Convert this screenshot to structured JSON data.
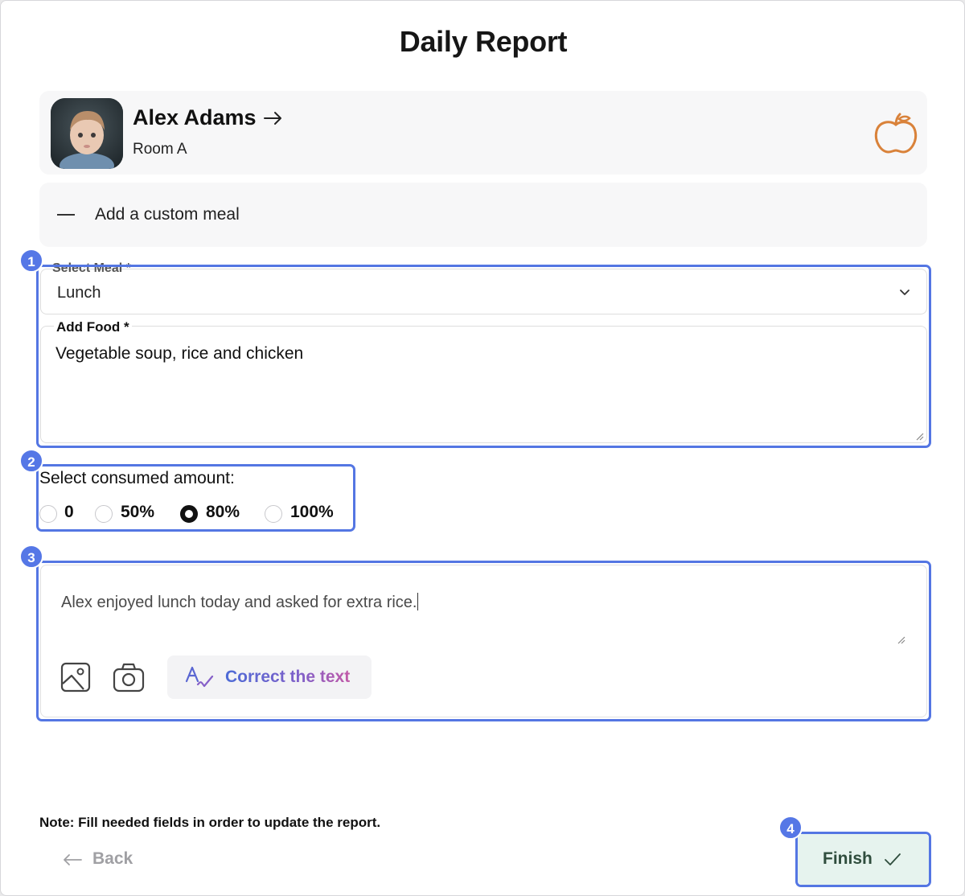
{
  "page": {
    "title": "Daily Report"
  },
  "child": {
    "name": "Alex Adams",
    "room": "Room A",
    "category_icon": "apple-icon"
  },
  "custom_meal": {
    "label": "Add a custom meal",
    "icon": "minus-icon"
  },
  "meal_select": {
    "label": "Select Meal *",
    "value": "Lunch"
  },
  "food": {
    "label": "Add Food *",
    "value": "Vegetable soup, rice and chicken"
  },
  "consumed": {
    "label": "Select consumed amount:",
    "options": [
      "0",
      "50%",
      "80%",
      "100%"
    ],
    "selected": "80%"
  },
  "notes": {
    "value": "Alex enjoyed lunch today and asked for extra rice.",
    "correct_label": "Correct the text"
  },
  "footer": {
    "note": "Note: Fill needed fields in order to update the report.",
    "back_label": "Back",
    "finish_label": "Finish"
  },
  "badges": [
    "1",
    "2",
    "3",
    "4"
  ],
  "colors": {
    "highlight": "#5476e3",
    "finish_bg": "#e6f3ee",
    "apple": "#d9823a"
  }
}
